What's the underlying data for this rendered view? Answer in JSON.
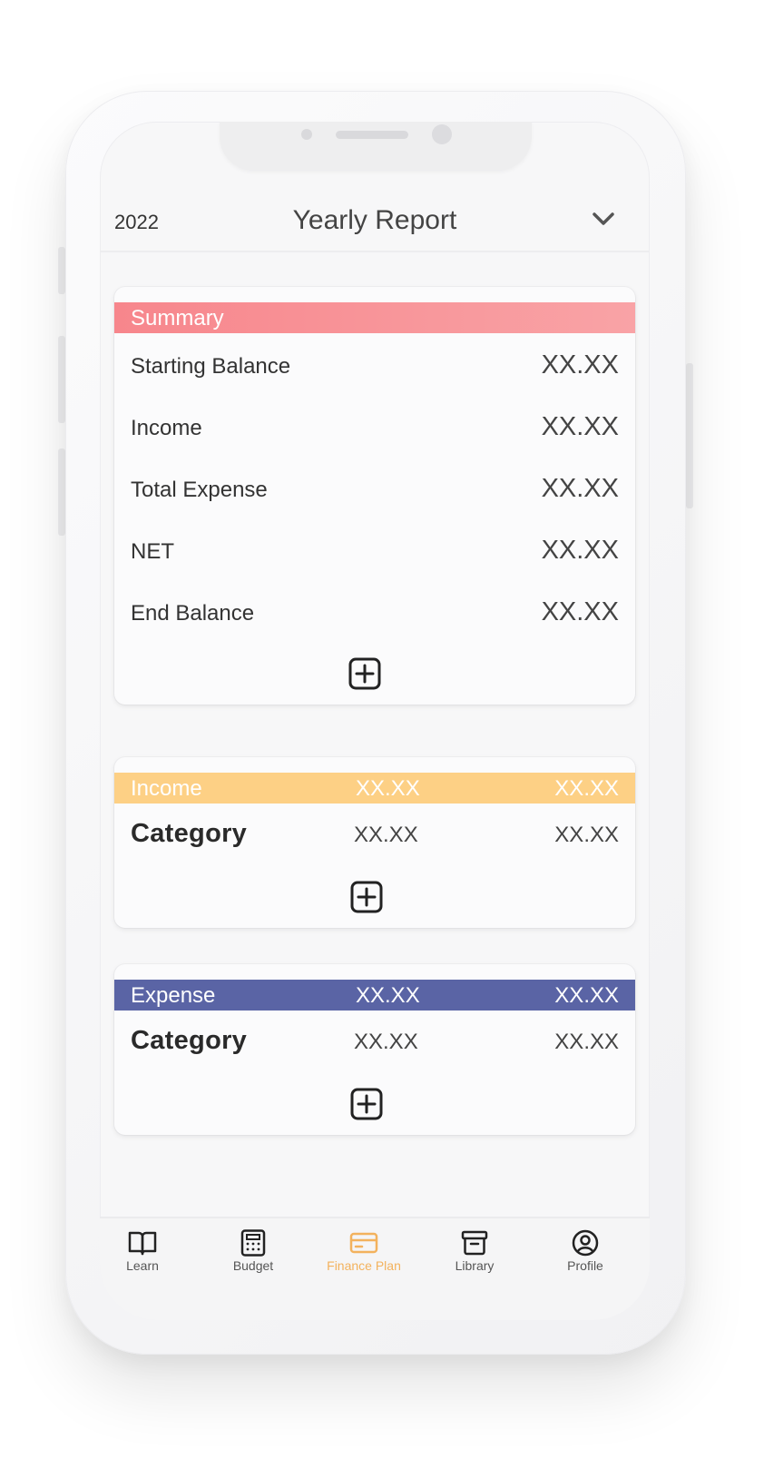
{
  "header": {
    "year": "2022",
    "title": "Yearly Report",
    "dropdown_icon": "chevron-down-icon"
  },
  "summary": {
    "title": "Summary",
    "color": "#f7868c",
    "rows": [
      {
        "label": "Starting Balance",
        "value": "XX.XX"
      },
      {
        "label": "Income",
        "value": "XX.XX"
      },
      {
        "label": "Total Expense",
        "value": "XX.XX"
      },
      {
        "label": "NET",
        "value": "XX.XX"
      },
      {
        "label": "End Balance",
        "value": "XX.XX"
      }
    ]
  },
  "income": {
    "title": "Income",
    "color": "#fdd085",
    "value1": "XX.XX",
    "value2": "XX.XX",
    "category": {
      "label": "Category",
      "value1": "XX.XX",
      "value2": "XX.XX"
    }
  },
  "expense": {
    "title": "Expense",
    "color": "#5a64a5",
    "value1": "XX.XX",
    "value2": "XX.XX",
    "category": {
      "label": "Category",
      "value1": "XX.XX",
      "value2": "XX.XX"
    }
  },
  "nav": {
    "active_color": "#f3b25d",
    "items": [
      {
        "label": "Learn",
        "icon": "book-icon"
      },
      {
        "label": "Budget",
        "icon": "calculator-icon"
      },
      {
        "label": "Finance Plan",
        "icon": "card-icon",
        "active": true
      },
      {
        "label": "Library",
        "icon": "archive-icon"
      },
      {
        "label": "Profile",
        "icon": "user-circle-icon"
      }
    ]
  }
}
